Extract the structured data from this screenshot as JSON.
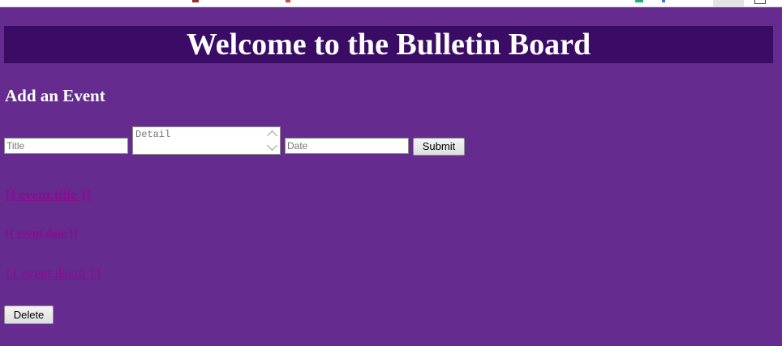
{
  "header": {
    "title": "Welcome to the Bulletin Board"
  },
  "form": {
    "heading": "Add an Event",
    "title_placeholder": "Title",
    "detail_placeholder": "Detail",
    "date_placeholder": "Date",
    "submit_label": "Submit"
  },
  "event": {
    "title": "{{ event.title }}",
    "date": "{{ event.date }}",
    "detail": "{{ event.detail }}",
    "delete_label": "Delete"
  },
  "colors": {
    "page_background": "#652b8f",
    "header_background": "#3a0c65",
    "heading_text": "#ffffff",
    "event_link_text": "#8b0c8f"
  },
  "icons": {
    "scroll_up": "chevron-up-icon",
    "scroll_down": "chevron-down-icon"
  }
}
